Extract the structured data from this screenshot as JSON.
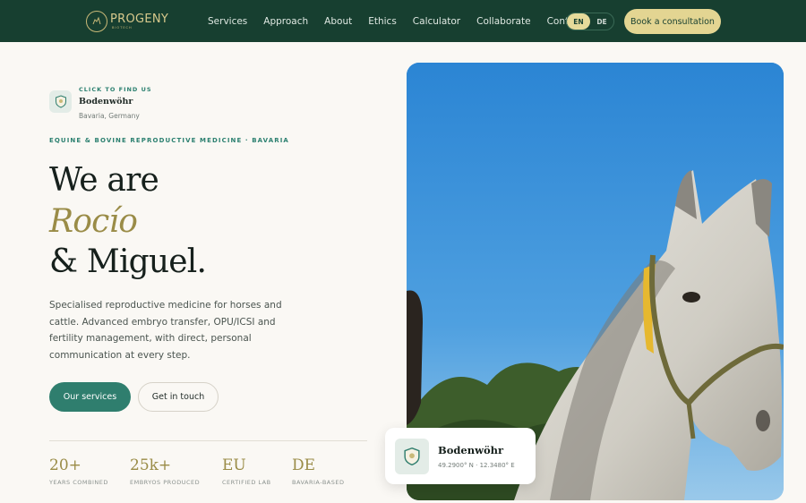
{
  "colors": {
    "nav_bg": "#173f30",
    "accent_gold": "#e3d592",
    "accent_teal": "#2f7e6e",
    "heading_italic": "#9a8c47"
  },
  "nav": {
    "logo_word": "PROGENY",
    "logo_sub": "BIOTECH",
    "logo_icon": "horse-emblem-icon",
    "links": [
      "Services",
      "Approach",
      "About",
      "Ethics",
      "Calculator",
      "Collaborate",
      "Contact"
    ],
    "lang": {
      "active": "EN",
      "other": "DE"
    },
    "cta": "Book a consultation"
  },
  "location": {
    "icon": "shield-location-icon",
    "kicker": "CLICK TO FIND US",
    "city": "Bodenwöhr",
    "country": "Bavaria, Germany"
  },
  "hero": {
    "eyebrow": "EQUINE & BOVINE REPRODUCTIVE MEDICINE · BAVARIA",
    "line1": "We are",
    "line2": "Rocío",
    "line3": "& Miguel.",
    "lead": "Specialised reproductive medicine for horses and cattle. Advanced embryo transfer, OPU/ICSI and fertility management, with direct, personal communication at every step.",
    "primary_button": "Our services",
    "secondary_button": "Get in touch"
  },
  "stats": [
    {
      "value": "20+",
      "label": "YEARS COMBINED"
    },
    {
      "value": "25k+",
      "label": "EMBRYOS PRODUCED"
    },
    {
      "value": "EU",
      "label": "CERTIFIED LAB"
    },
    {
      "value": "DE",
      "label": "BAVARIA-BASED"
    }
  ],
  "map_card": {
    "icon": "shield-location-icon",
    "city": "Bodenwöhr",
    "coords": "49.2900° N · 12.3480° E"
  }
}
